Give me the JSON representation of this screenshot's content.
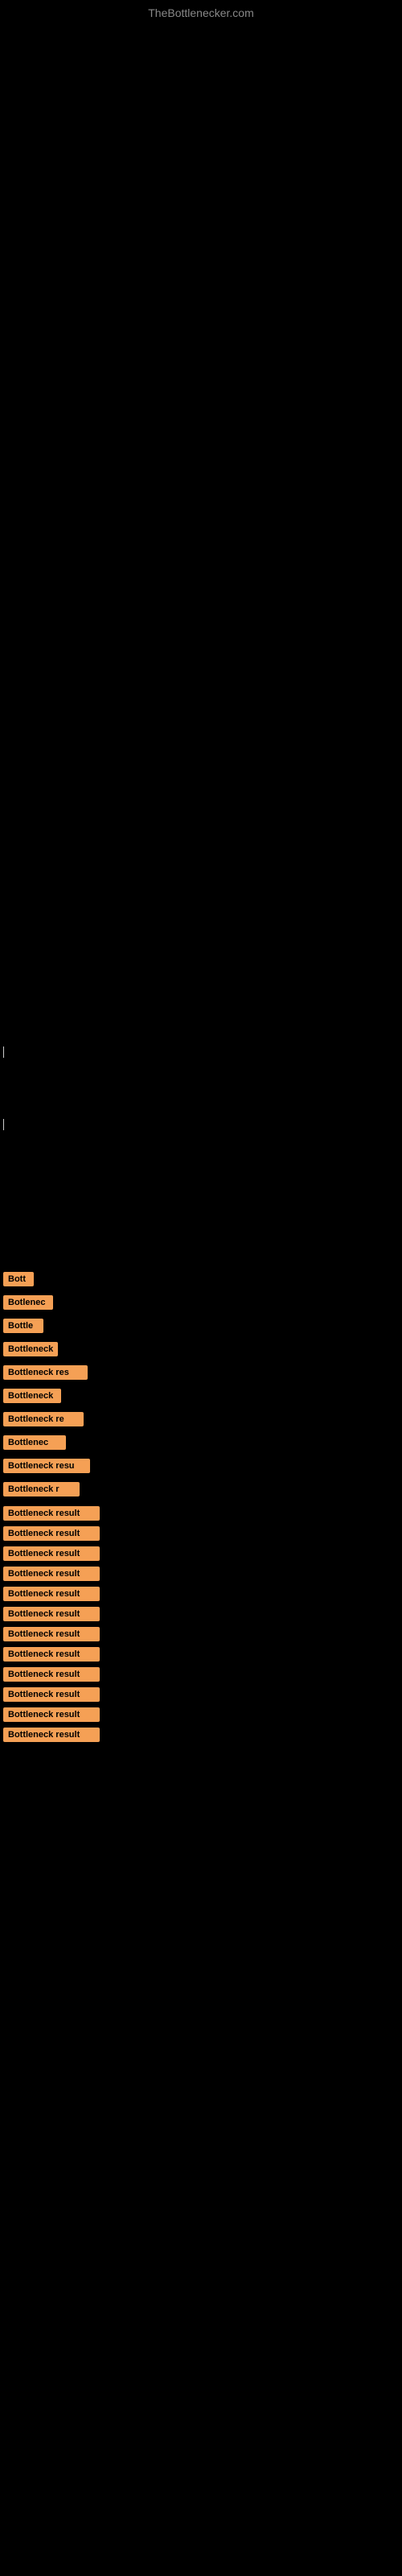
{
  "site": {
    "title": "TheBottlenecker.com"
  },
  "bottleneck_items": [
    {
      "id": 1,
      "label": "Bottleneck result",
      "display": "Bott"
    },
    {
      "id": 2,
      "label": "Bottleneck result",
      "display": "Botlenec"
    },
    {
      "id": 3,
      "label": "Bottleneck result",
      "display": "Bottle"
    },
    {
      "id": 4,
      "label": "Bottleneck result",
      "display": "Bottleneck"
    },
    {
      "id": 5,
      "label": "Bottleneck result",
      "display": "Bottleneck res"
    },
    {
      "id": 6,
      "label": "Bottleneck result",
      "display": "Bottleneck"
    },
    {
      "id": 7,
      "label": "Bottleneck result",
      "display": "Bottleneck re"
    },
    {
      "id": 8,
      "label": "Bottleneck result",
      "display": "Bottlenec"
    },
    {
      "id": 9,
      "label": "Bottleneck result",
      "display": "Bottleneck resu"
    },
    {
      "id": 10,
      "label": "Bottleneck result",
      "display": "Bottleneck r"
    },
    {
      "id": 11,
      "label": "Bottleneck result",
      "display": "Bottleneck result"
    },
    {
      "id": 12,
      "label": "Bottleneck result",
      "display": "Bottleneck result"
    },
    {
      "id": 13,
      "label": "Bottleneck result",
      "display": "Bottleneck result"
    },
    {
      "id": 14,
      "label": "Bottleneck result",
      "display": "Bottleneck result"
    },
    {
      "id": 15,
      "label": "Bottleneck result",
      "display": "Bottleneck result"
    },
    {
      "id": 16,
      "label": "Bottleneck result",
      "display": "Bottleneck result"
    },
    {
      "id": 17,
      "label": "Bottleneck result",
      "display": "Bottleneck result"
    },
    {
      "id": 18,
      "label": "Bottleneck result",
      "display": "Bottleneck result"
    },
    {
      "id": 19,
      "label": "Bottleneck result",
      "display": "Bottleneck result"
    },
    {
      "id": 20,
      "label": "Bottleneck result",
      "display": "Bottleneck result"
    },
    {
      "id": 21,
      "label": "Bottleneck result",
      "display": "Bottleneck result"
    },
    {
      "id": 22,
      "label": "Bottleneck result",
      "display": "Bottleneck result"
    }
  ],
  "colors": {
    "background": "#000000",
    "label_bg": "#f5a055",
    "label_text": "#000000",
    "site_title": "#888888"
  }
}
